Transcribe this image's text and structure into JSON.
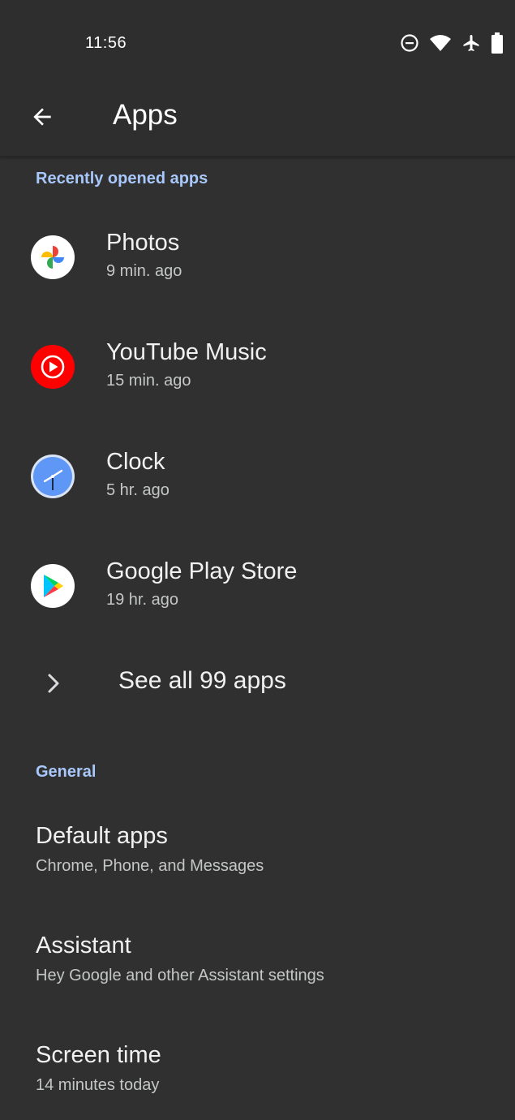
{
  "status_bar": {
    "time": "11:56",
    "icons": [
      "do-not-disturb-icon",
      "wifi-icon",
      "airplane-mode-icon",
      "battery-icon"
    ]
  },
  "app_bar": {
    "title": "Apps",
    "back_icon": "arrow-back-icon"
  },
  "recent": {
    "header": "Recently opened apps",
    "apps": [
      {
        "name": "Photos",
        "last_opened": "9 min. ago",
        "icon": "google-photos-icon"
      },
      {
        "name": "YouTube Music",
        "last_opened": "15 min. ago",
        "icon": "youtube-music-icon"
      },
      {
        "name": "Clock",
        "last_opened": "5 hr. ago",
        "icon": "clock-icon"
      },
      {
        "name": "Google Play Store",
        "last_opened": "19 hr. ago",
        "icon": "play-store-icon"
      }
    ],
    "see_all": "See all 99 apps"
  },
  "general": {
    "header": "General",
    "items": [
      {
        "title": "Default apps",
        "subtitle": "Chrome, Phone, and Messages"
      },
      {
        "title": "Assistant",
        "subtitle": "Hey Google and other Assistant settings"
      },
      {
        "title": "Screen time",
        "subtitle": "14 minutes today"
      }
    ]
  },
  "colors": {
    "background": "#303030",
    "section_header": "#a8c7fa",
    "youtube_red": "#ff0000",
    "clock_blue": "#5e97f6"
  }
}
